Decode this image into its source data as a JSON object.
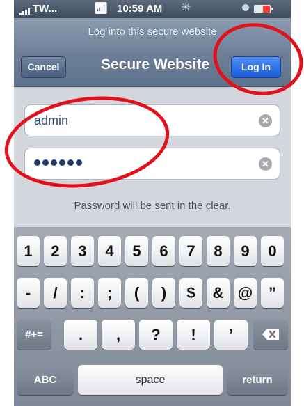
{
  "status_bar": {
    "carrier": "TW...",
    "wifi_icon": "wifi-icon",
    "time": "10:59 AM",
    "activity_icon": "spinner-icon",
    "battery_icon": "battery-icon"
  },
  "nav": {
    "prompt": "Log into this secure website",
    "title": "Secure Website",
    "cancel_label": "Cancel",
    "login_label": "Log In"
  },
  "form": {
    "username_value": "admin",
    "password_mask_count": 6,
    "clear_icon": "clear-icon",
    "notice": "Password will be sent in the clear."
  },
  "keyboard": {
    "row1": [
      "1",
      "2",
      "3",
      "4",
      "5",
      "6",
      "7",
      "8",
      "9",
      "0"
    ],
    "row2": [
      "-",
      "/",
      ":",
      ";",
      "(",
      ")",
      "$",
      "&",
      "@",
      "”"
    ],
    "row3": {
      "toggle": "#+=",
      "keys": [
        ".",
        ",",
        "?",
        "!",
        "’"
      ],
      "delete_icon": "backspace-icon"
    },
    "row4": {
      "abc": "ABC",
      "space": "space",
      "return": "return"
    }
  },
  "annotation_color": "#e3111b"
}
